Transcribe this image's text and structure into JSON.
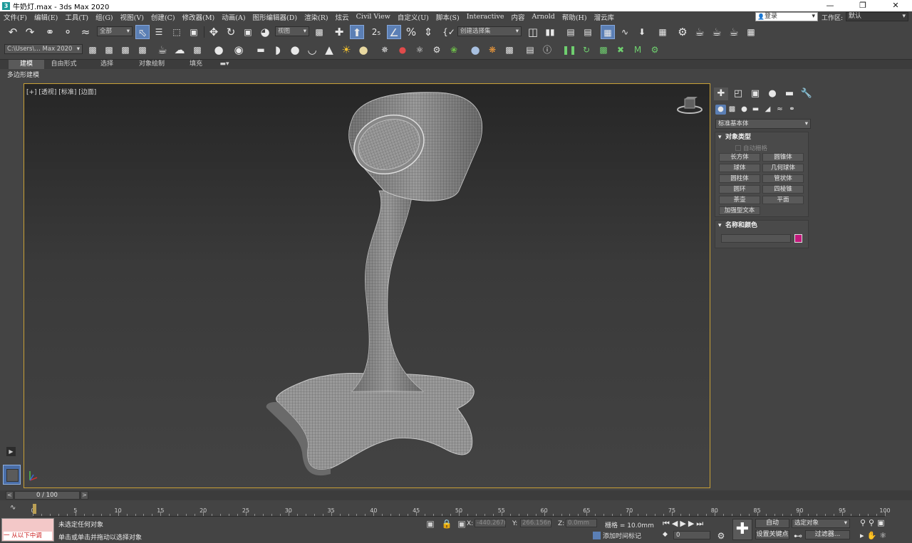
{
  "window": {
    "title": "牛奶灯.max - 3ds Max 2020",
    "app_icon_text": "3",
    "controls": [
      "minimize-icon",
      "restore-icon",
      "close-icon"
    ]
  },
  "menubar": {
    "items": [
      "文件(F)",
      "编辑(E)",
      "工具(T)",
      "组(G)",
      "视图(V)",
      "创建(C)",
      "修改器(M)",
      "动画(A)",
      "图形编辑器(D)",
      "渲染(R)",
      "炫云",
      "Civil View",
      "自定义(U)",
      "脚本(S)",
      "Interactive",
      "内容",
      "Arnold",
      "帮助(H)",
      "溜云库"
    ],
    "login": "登录",
    "workspace_label": "工作区:",
    "workspace_value": "默认"
  },
  "toolbar1": {
    "selection_filter": "全部",
    "ref_coord": "视图",
    "named_selection": "创建选择集",
    "icons": [
      "undo-icon",
      "redo-icon",
      "link-icon",
      "unlink-icon",
      "bind-spacewarp-icon",
      "select-object-icon",
      "select-by-name-icon",
      "rect-region-icon",
      "window-crossing-icon",
      "move-icon",
      "rotate-icon",
      "scale-icon",
      "placement-icon",
      "use-pivot-icon",
      "select-manipulate-icon",
      "keyboard-shortcut-icon",
      "snap-icon",
      "angle-snap-icon",
      "percent-snap-icon",
      "spinner-snap-icon",
      "edit-named-sel-icon",
      "mirror-icon",
      "align-icon",
      "toggle-scene-explorer-icon",
      "toggle-layer-explorer-icon",
      "ribbon-icon",
      "curve-editor-icon",
      "schematic-view-icon",
      "material-editor-icon",
      "render-setup-icon",
      "rendered-frame-icon",
      "render-icon",
      "render-iterative-icon",
      "arnold-icon"
    ]
  },
  "toolbar2": {
    "path": "C:\\Users\\… Max 2020",
    "icons": [
      "project-folder-icon",
      "layer-icon",
      "layer-add-icon",
      "layer-select-icon",
      "teapot-icon",
      "cloud-icon",
      "render-frame-icon",
      "light-bulb-icon",
      "camera-icon",
      "box-icon",
      "hemisphere-icon",
      "sphere-icon",
      "bowl-icon",
      "cone-icon",
      "sun-icon",
      "sphere-gold-icon",
      "particle-icon",
      "color-dots-icon",
      "reactor-icon",
      "gear-green-icon",
      "grass-icon",
      "globe-icon",
      "color-balls-icon",
      "video-post-icon",
      "manual-icon",
      "help-icon",
      "pause-icon",
      "flow-icon",
      "grid-icon",
      "target-icon",
      "m-icon",
      "settings-icon"
    ]
  },
  "ribbon": {
    "tabs": [
      "建模",
      "自由形式",
      "选择",
      "对象绘制",
      "填充"
    ],
    "active_tab": "建模",
    "sublabel": "多边形建模"
  },
  "viewport": {
    "label": "[+] [透视] [标准] [边面]",
    "background_top": "#262626",
    "wire_color": "#cfcfcf",
    "border_color": "#c8a036"
  },
  "command_panel": {
    "tabs": [
      "create-tab-icon",
      "modify-tab-icon",
      "hierarchy-tab-icon",
      "motion-tab-icon",
      "display-tab-icon",
      "utilities-tab-icon"
    ],
    "subtabs": [
      "geometry-icon",
      "shapes-icon",
      "lights-icon",
      "cameras-icon",
      "helpers-icon",
      "spacewarps-icon",
      "systems-icon"
    ],
    "category": "标准基本体",
    "object_type_title": "对象类型",
    "autogrid": "自动栅格",
    "primitives": [
      "长方体",
      "圆锥体",
      "球体",
      "几何球体",
      "圆柱体",
      "管状体",
      "圆环",
      "四棱锥",
      "茶壶",
      "平面",
      "加强型文本"
    ],
    "name_color_title": "名称和颜色",
    "object_color": "#c2197c"
  },
  "timeslider": {
    "value": "0 / 100",
    "left": "<",
    "right": ">"
  },
  "trackbar": {
    "labels": [
      "0",
      "5",
      "10",
      "15",
      "20",
      "25",
      "30",
      "35",
      "40",
      "45",
      "50",
      "55",
      "60",
      "65",
      "70",
      "75",
      "80",
      "85",
      "90",
      "95",
      "100"
    ]
  },
  "statusbar": {
    "maxscript": "一  从以下中调",
    "status1": "未选定任何对象",
    "status2": "单击或单击并拖动以选择对象",
    "x_label": "X:",
    "x_value": "-440.267m",
    "y_label": "Y:",
    "y_value": "266.156mm",
    "z_label": "Z:",
    "z_value": "0.0mm",
    "grid": "栅格 = 10.0mm",
    "add_time_tag": "添加时间标记",
    "frame": "0",
    "auto_key": "自动",
    "set_key": "设置关键点",
    "selected_object": "选定对象",
    "filters": "过滤器..."
  }
}
